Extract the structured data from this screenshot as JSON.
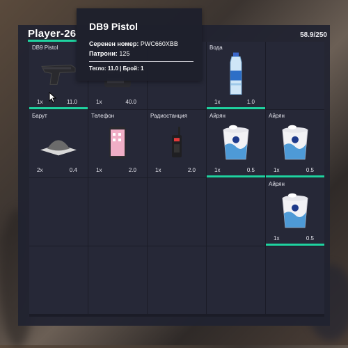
{
  "player": {
    "name": "Player-26",
    "weight": "58.9/250"
  },
  "tooltip": {
    "title": "DB9 Pistol",
    "serial_label": "Серенен номер:",
    "serial_value": "PWC660XBB",
    "ammo_label": "Патрони:",
    "ammo_value": "125",
    "footer": "Тегло: 11.0 | Брой: 1"
  },
  "colors": {
    "accent": "#1fd3a0",
    "panel": "#202230",
    "slot": "#262837"
  },
  "slots": [
    {
      "label": "DB9 Pistol",
      "qty": "1x",
      "weight": "11.0",
      "icon": "pistol-icon",
      "bar": true
    },
    {
      "label": "",
      "qty": "1x",
      "weight": "40.0",
      "icon": "vest-icon",
      "bar": false
    },
    {
      "label": "",
      "qty": "",
      "weight": "",
      "icon": "",
      "bar": false
    },
    {
      "label": "Вода",
      "qty": "1x",
      "weight": "1.0",
      "icon": "water-bottle-icon",
      "bar": true
    },
    {
      "label": "",
      "qty": "",
      "weight": "",
      "icon": "",
      "bar": false
    },
    {
      "label": "Барут",
      "qty": "2x",
      "weight": "0.4",
      "icon": "gunpowder-icon",
      "bar": false
    },
    {
      "label": "Телефон",
      "qty": "1x",
      "weight": "2.0",
      "icon": "phone-icon",
      "bar": false
    },
    {
      "label": "Радиостанция",
      "qty": "1x",
      "weight": "2.0",
      "icon": "radio-icon",
      "bar": false
    },
    {
      "label": "Айрян",
      "qty": "1x",
      "weight": "0.5",
      "icon": "ayran-cup-icon",
      "bar": true
    },
    {
      "label": "Айрян",
      "qty": "1x",
      "weight": "0.5",
      "icon": "ayran-cup-icon",
      "bar": true
    },
    {
      "label": "",
      "qty": "",
      "weight": "",
      "icon": "",
      "bar": false
    },
    {
      "label": "",
      "qty": "",
      "weight": "",
      "icon": "",
      "bar": false
    },
    {
      "label": "",
      "qty": "",
      "weight": "",
      "icon": "",
      "bar": false
    },
    {
      "label": "",
      "qty": "",
      "weight": "",
      "icon": "",
      "bar": false
    },
    {
      "label": "Айрян",
      "qty": "1x",
      "weight": "0.5",
      "icon": "ayran-cup-icon",
      "bar": true
    },
    {
      "label": "",
      "qty": "",
      "weight": "",
      "icon": "",
      "bar": false
    },
    {
      "label": "",
      "qty": "",
      "weight": "",
      "icon": "",
      "bar": false
    },
    {
      "label": "",
      "qty": "",
      "weight": "",
      "icon": "",
      "bar": false
    },
    {
      "label": "",
      "qty": "",
      "weight": "",
      "icon": "",
      "bar": false
    },
    {
      "label": "",
      "qty": "",
      "weight": "",
      "icon": "",
      "bar": false
    }
  ]
}
